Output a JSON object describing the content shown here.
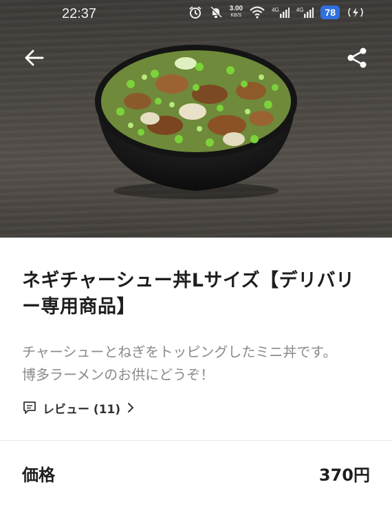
{
  "status_bar": {
    "time": "22:37",
    "net_speed": "3.00",
    "net_unit": "KB/S",
    "network_1": "4G",
    "network_2": "4G",
    "battery": "78"
  },
  "header": {
    "back_icon": "arrow-left-icon",
    "share_icon": "share-icon"
  },
  "product": {
    "image": "negi-chashu-don-photo",
    "title": "ネギチャーシュー丼Lサイズ【デリバリー専用商品】",
    "description": "チャーシューとねぎをトッピングしたミニ丼です。\n博多ラーメンのお供にどうぞ！",
    "review_label": "レビュー (11)"
  },
  "price": {
    "label": "価格",
    "value": "370円"
  },
  "colors": {
    "accent_battery": "#2f6fde",
    "text_primary": "#1e1e1e",
    "text_secondary": "#8a8a8a"
  }
}
